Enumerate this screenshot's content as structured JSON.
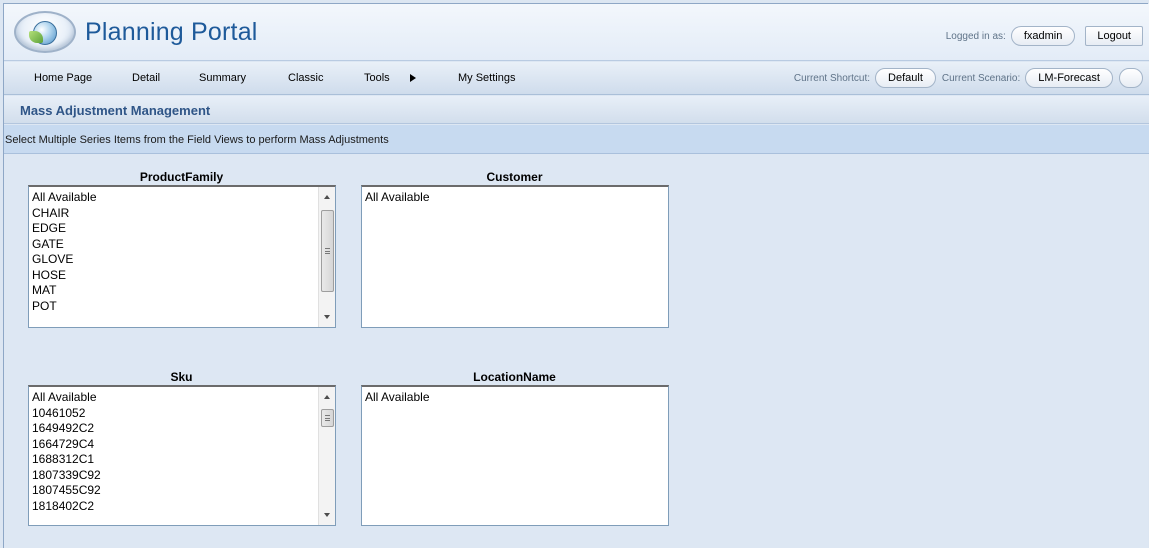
{
  "header": {
    "app_title": "Planning Portal",
    "logged_in_label": "Logged in as:",
    "username": "fxadmin",
    "logout_label": "Logout"
  },
  "nav": {
    "items": [
      "Home Page",
      "Detail",
      "Summary",
      "Classic",
      "Tools",
      "My Settings"
    ],
    "shortcut_label": "Current Shortcut:",
    "shortcut_value": "Default",
    "scenario_label": "Current Scenario:",
    "scenario_value": "LM-Forecast"
  },
  "section": {
    "title": "Mass Adjustment Management",
    "instructions": "Select Multiple Series Items from the Field Views to perform Mass Adjustments"
  },
  "field_views": {
    "product_family": {
      "label": "ProductFamily",
      "items": [
        "All Available",
        "CHAIR",
        "EDGE",
        "GATE",
        "GLOVE",
        "HOSE",
        "MAT",
        "POT"
      ]
    },
    "customer": {
      "label": "Customer",
      "items": [
        "All Available"
      ]
    },
    "sku": {
      "label": "Sku",
      "items": [
        "All Available",
        "10461052",
        "1649492C2",
        "1664729C4",
        "1688312C1",
        "1807339C92",
        "1807455C92",
        "1818402C2"
      ]
    },
    "location_name": {
      "label": "LocationName",
      "items": [
        "All Available"
      ]
    }
  }
}
